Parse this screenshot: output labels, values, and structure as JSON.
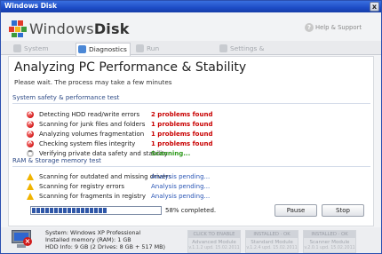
{
  "window": {
    "title": "Windows Disk",
    "close_glyph": "x"
  },
  "header": {
    "brand_prefix": "Windows",
    "brand_bold": "Disk",
    "help_label": "Help & Support"
  },
  "tabs": [
    {
      "label": "System Status",
      "icon": "monitor-icon",
      "active": false
    },
    {
      "label": "Diagnostics",
      "icon": "diagnostics-icon",
      "active": true
    },
    {
      "label": "Run Defragmentation",
      "icon": "defrag-icon",
      "active": false
    },
    {
      "label": "Settings & Options",
      "icon": "settings-icon",
      "active": false
    }
  ],
  "main": {
    "title": "Analyzing PC Performance & Stability",
    "subtitle": "Please wait. The process may take a few minutes",
    "section1": {
      "title": "System safety & performance test",
      "items": [
        {
          "label": "Detecting HDD read/write errors",
          "result": "2 problems found",
          "status": "error"
        },
        {
          "label": "Scanning for junk files and folders",
          "result": "1 problems found",
          "status": "error"
        },
        {
          "label": "Analyzing volumes fragmentation",
          "result": "1 problems found",
          "status": "error"
        },
        {
          "label": "Checking system files integrity",
          "result": "1 problems found",
          "status": "error"
        },
        {
          "label": "Verifying private data safety and stability",
          "result": "Scanning...",
          "status": "scanning"
        }
      ]
    },
    "section2": {
      "title": "RAM & Storage memory test",
      "items": [
        {
          "label": "Scanning for outdated and missing drivers",
          "result": "Analysis pending...",
          "status": "warning"
        },
        {
          "label": "Scanning for registry errors",
          "result": "Analysis pending...",
          "status": "warning"
        },
        {
          "label": "Scanning for fragments in registry",
          "result": "Analysis pending...",
          "status": "warning"
        }
      ]
    },
    "progress": {
      "percent": 58,
      "label": "58% completed."
    },
    "buttons": {
      "pause": "Pause",
      "stop": "Stop"
    }
  },
  "footer": {
    "system": "System: Windows XP Professional",
    "memory": "Installed memory (RAM): 1 GB",
    "hdd": "HDD Info: 9 GB (2 Drives: 8 GB + 517 MB)",
    "modules": [
      {
        "caption": "CLICK TO ENABLE",
        "name": "Advanced Module",
        "version": "v.1.1.2 upd. 15.02.2011"
      },
      {
        "caption": "INSTALLED · OK",
        "name": "Standard Module",
        "version": "v.1.2.4 upd. 15.02.2011"
      },
      {
        "caption": "INSTALLED · OK",
        "name": "Scanner Module",
        "version": "v.2.0.1 upd. 15.02.2011"
      }
    ]
  },
  "colors": {
    "error": "#c80000",
    "scanning": "#2e9a1b",
    "pending": "#2b56b5",
    "title_bar": "#1d4cc6"
  }
}
